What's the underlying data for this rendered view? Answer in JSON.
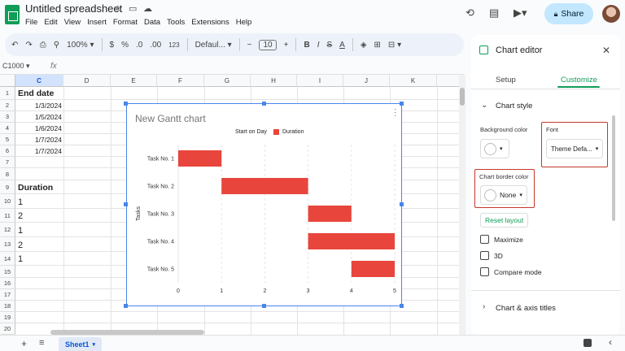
{
  "app": {
    "doc_title": "Untitled spreadsheet",
    "menu": [
      "File",
      "Edit",
      "View",
      "Insert",
      "Format",
      "Data",
      "Tools",
      "Extensions",
      "Help"
    ],
    "share_label": "Share"
  },
  "toolbar": {
    "zoom": "100%",
    "currency": "$",
    "percent": "%",
    "decimal_dec": ".0",
    "decimal_inc": ".00",
    "number_format": "123",
    "font": "Defaul...",
    "font_size": "10",
    "bold": "B",
    "italic": "I",
    "text_color": "A"
  },
  "formula_bar": {
    "name_box": "C1000",
    "fx": "fx"
  },
  "grid": {
    "columns": [
      "C",
      "D",
      "E",
      "F",
      "G",
      "H",
      "I",
      "J",
      "K"
    ],
    "rows": [
      "1",
      "2",
      "3",
      "4",
      "5",
      "6",
      "7",
      "8",
      "9",
      "10",
      "11",
      "12",
      "13",
      "14",
      "15",
      "16",
      "17",
      "18",
      "19",
      "20"
    ],
    "cells": {
      "c1": "End date",
      "c2": "1/3/2024",
      "c3": "1/5/2024",
      "c4": "1/6/2024",
      "c5": "1/7/2024",
      "c6": "1/7/2024",
      "c9": "Duration",
      "c10": "1",
      "c11": "2",
      "c12": "1",
      "c13": "2",
      "c14": "1"
    }
  },
  "sheet_tab": "Sheet1",
  "chart_data": {
    "type": "bar",
    "orientation": "horizontal",
    "stacked": true,
    "title": "New Gantt chart",
    "categories": [
      "Task No. 1",
      "Task No. 2",
      "Task No. 3",
      "Task No. 4",
      "Task No. 5"
    ],
    "series": [
      {
        "name": "Start on Day",
        "values": [
          0,
          1,
          3,
          3,
          4
        ],
        "color": "transparent"
      },
      {
        "name": "Duration",
        "values": [
          1,
          2,
          1,
          2,
          1
        ],
        "color": "#e8453c"
      }
    ],
    "ylabel": "Tasks",
    "xlim": [
      0,
      5
    ],
    "x_ticks": [
      "0",
      "1",
      "2",
      "3",
      "4",
      "5"
    ],
    "grid": true,
    "legend": "top"
  },
  "editor": {
    "title": "Chart editor",
    "tabs": [
      "Setup",
      "Customize"
    ],
    "active_tab": "Customize",
    "section_chart_style": "Chart style",
    "background_color_label": "Background color",
    "font_label": "Font",
    "font_value": "Theme Defa...",
    "border_color_label": "Chart border color",
    "border_color_value": "None",
    "reset_layout": "Reset layout",
    "maximize": "Maximize",
    "three_d": "3D",
    "compare_mode": "Compare mode",
    "section_chart_axis": "Chart & axis titles",
    "accent": "#0f9d58",
    "highlight": "#c5372a"
  }
}
